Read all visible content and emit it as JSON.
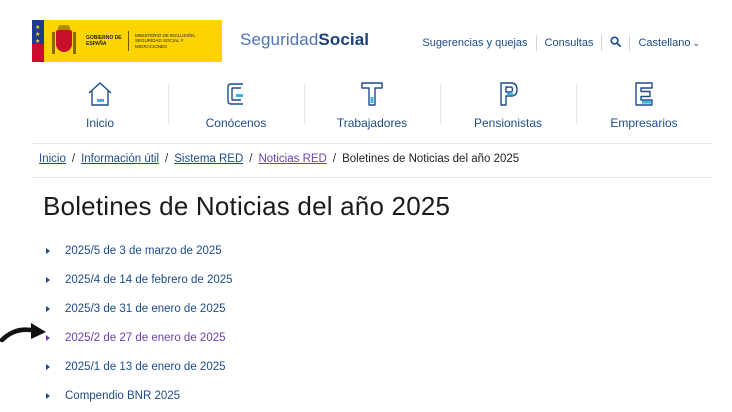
{
  "header": {
    "gov_logo": {
      "gobierno": "GOBIERNO DE ESPAÑA",
      "ministerio": "MINISTERIO DE INCLUSIÓN, SEGURIDAD SOCIAL Y MIGRACIONES"
    },
    "brand": {
      "part1": "Seguridad",
      "part2": "Social"
    },
    "links": [
      {
        "label": "Sugerencias y quejas"
      },
      {
        "label": "Consultas"
      }
    ],
    "search_icon": "search-icon",
    "language": "Castellano"
  },
  "nav": {
    "items": [
      {
        "label": "Inicio",
        "icon": "home-icon"
      },
      {
        "label": "Conócenos",
        "icon": "letter-c-icon"
      },
      {
        "label": "Trabajadores",
        "icon": "letter-t-icon"
      },
      {
        "label": "Pensionistas",
        "icon": "letter-p-icon"
      },
      {
        "label": "Empresarios",
        "icon": "letter-e-icon"
      }
    ]
  },
  "breadcrumb": {
    "items": [
      "Inicio",
      "Información útil",
      "Sistema RED",
      "Noticias RED"
    ],
    "separator": "/",
    "current": "Boletines de Noticias del año 2025"
  },
  "page_title": "Boletines de Noticias del año 2025",
  "bulletins": [
    {
      "label": "2025/5 de 3 de marzo de 2025",
      "visited": false
    },
    {
      "label": "2025/4 de 14 de febrero de 2025",
      "visited": false
    },
    {
      "label": "2025/3 de 31 de enero de 2025",
      "visited": false
    },
    {
      "label": "2025/2 de 27 de enero de 2025",
      "visited": true
    },
    {
      "label": "2025/1 de 13 de enero de 2025",
      "visited": false
    },
    {
      "label": "Compendio BNR 2025",
      "visited": false
    }
  ],
  "colors": {
    "link": "#1c4b8a",
    "visited": "#6a3fb0",
    "gov_yellow": "#fcd500",
    "brand_light": "#4a74b5",
    "brand_dark": "#1a3f7a"
  }
}
